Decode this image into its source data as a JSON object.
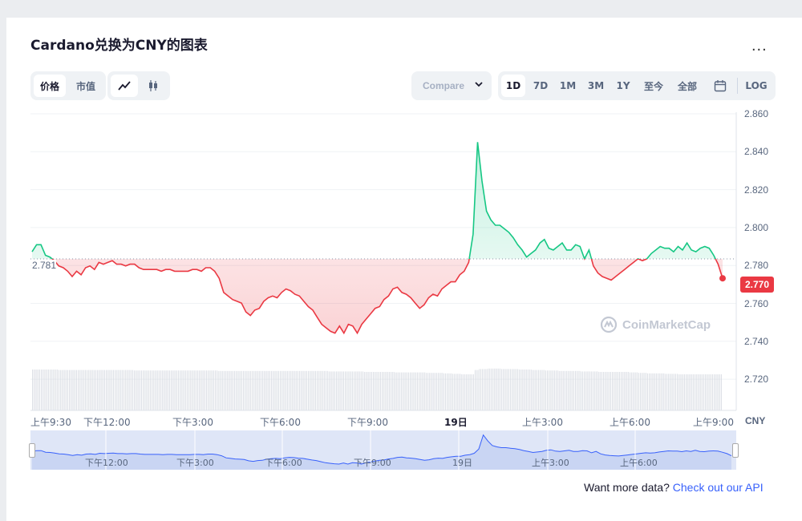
{
  "title": "Cardano兑换为CNY的图表",
  "more_label": "...",
  "tabs_type": [
    "价格",
    "市值"
  ],
  "compare_label": "Compare",
  "ranges": [
    "1D",
    "7D",
    "1M",
    "3M",
    "1Y",
    "至今",
    "全部"
  ],
  "log_label": "LOG",
  "currency": "CNY",
  "current_price": "2.770",
  "reference_price": "2.781",
  "watermark": "CoinMarketCap",
  "footer_text": "Want more data?",
  "footer_link": "Check out our API",
  "colors": {
    "up": "#16c784",
    "down": "#ea3943",
    "nav": "#3861fb"
  },
  "chart_data": {
    "type": "line",
    "y_ticks": [
      "2.860",
      "2.840",
      "2.820",
      "2.800",
      "2.780",
      "2.760",
      "2.740",
      "2.720"
    ],
    "ylim": [
      2.713,
      2.863
    ],
    "x_ticks": [
      "上午9:30",
      "下午12:00",
      "下午3:00",
      "下午6:00",
      "下午9:00",
      "19日",
      "上午3:00",
      "上午6:00",
      "上午9:00"
    ],
    "navigator_ticks": [
      "下午12:00",
      "下午3:00",
      "下午6:00",
      "下午9:00",
      "19日",
      "上午3:00",
      "上午6:00"
    ],
    "baseline": 2.781,
    "series": [
      {
        "values": [
          2.785,
          2.789,
          2.789,
          2.783,
          2.782,
          2.78,
          2.777,
          2.776,
          2.774,
          2.771,
          2.774,
          2.772,
          2.776,
          2.777,
          2.775,
          2.779,
          2.778,
          2.779,
          2.78,
          2.778,
          2.778,
          2.777,
          2.778,
          2.778,
          2.776,
          2.775,
          2.775,
          2.775,
          2.775,
          2.774,
          2.775,
          2.775,
          2.774,
          2.774,
          2.774,
          2.774,
          2.775,
          2.775,
          2.774,
          2.776,
          2.776,
          2.774,
          2.77,
          2.762,
          2.76,
          2.758,
          2.757,
          2.756,
          2.751,
          2.749,
          2.752,
          2.753,
          2.757,
          2.759,
          2.76,
          2.759,
          2.762,
          2.764,
          2.763,
          2.761,
          2.76,
          2.757,
          2.754,
          2.752,
          2.748,
          2.744,
          2.742,
          2.74,
          2.739,
          2.743,
          2.739,
          2.744,
          2.743,
          2.739,
          2.744,
          2.747,
          2.75,
          2.753,
          2.754,
          2.758,
          2.76,
          2.764,
          2.765,
          2.762,
          2.761,
          2.759,
          2.756,
          2.753,
          2.755,
          2.759,
          2.761,
          2.76,
          2.764,
          2.766,
          2.768,
          2.768,
          2.772,
          2.774,
          2.779,
          2.795,
          2.847,
          2.825,
          2.808,
          2.803,
          2.8,
          2.8,
          2.798,
          2.796,
          2.793,
          2.789,
          2.786,
          2.782,
          2.784,
          2.786,
          2.79,
          2.792,
          2.787,
          2.786,
          2.788,
          2.79,
          2.786,
          2.786,
          2.789,
          2.788,
          2.781,
          2.786,
          2.777,
          2.773,
          2.771,
          2.77,
          2.769,
          2.771,
          2.773,
          2.775,
          2.777,
          2.779,
          2.781,
          2.78,
          2.781,
          2.784,
          2.786,
          2.788,
          2.787,
          2.787,
          2.785,
          2.788,
          2.786,
          2.79,
          2.786,
          2.785,
          2.787,
          2.788,
          2.787,
          2.783,
          2.778,
          2.77
        ],
        "volume": [
          0.85,
          0.85,
          0.85,
          0.85,
          0.85,
          0.85,
          0.84,
          0.84,
          0.84,
          0.84,
          0.84,
          0.84,
          0.84,
          0.84,
          0.84,
          0.84,
          0.84,
          0.84,
          0.84,
          0.84,
          0.84,
          0.84,
          0.84,
          0.83,
          0.83,
          0.83,
          0.83,
          0.83,
          0.83,
          0.83,
          0.83,
          0.83,
          0.83,
          0.83,
          0.83,
          0.83,
          0.83,
          0.83,
          0.83,
          0.83,
          0.83,
          0.83,
          0.82,
          0.82,
          0.82,
          0.82,
          0.82,
          0.82,
          0.82,
          0.82,
          0.82,
          0.82,
          0.82,
          0.82,
          0.82,
          0.82,
          0.82,
          0.82,
          0.82,
          0.82,
          0.82,
          0.82,
          0.82,
          0.82,
          0.82,
          0.82,
          0.82,
          0.81,
          0.81,
          0.81,
          0.81,
          0.81,
          0.81,
          0.81,
          0.81,
          0.8,
          0.8,
          0.8,
          0.8,
          0.8,
          0.8,
          0.8,
          0.79,
          0.79,
          0.79,
          0.79,
          0.79,
          0.79,
          0.79,
          0.78,
          0.78,
          0.78,
          0.78,
          0.77,
          0.77,
          0.76,
          0.76,
          0.75,
          0.75,
          0.75,
          0.84,
          0.86,
          0.86,
          0.87,
          0.87,
          0.87,
          0.86,
          0.86,
          0.86,
          0.86,
          0.85,
          0.85,
          0.85,
          0.84,
          0.84,
          0.84,
          0.83,
          0.83,
          0.83,
          0.82,
          0.82,
          0.82,
          0.82,
          0.82,
          0.81,
          0.81,
          0.81,
          0.81,
          0.8,
          0.8,
          0.8,
          0.8,
          0.8,
          0.8,
          0.8,
          0.79,
          0.79,
          0.78,
          0.78,
          0.77,
          0.77,
          0.77,
          0.77,
          0.76,
          0.76,
          0.76,
          0.75,
          0.75,
          0.75,
          0.75,
          0.75,
          0.75,
          0.75,
          0.75,
          0.75,
          0.75
        ]
      }
    ]
  }
}
